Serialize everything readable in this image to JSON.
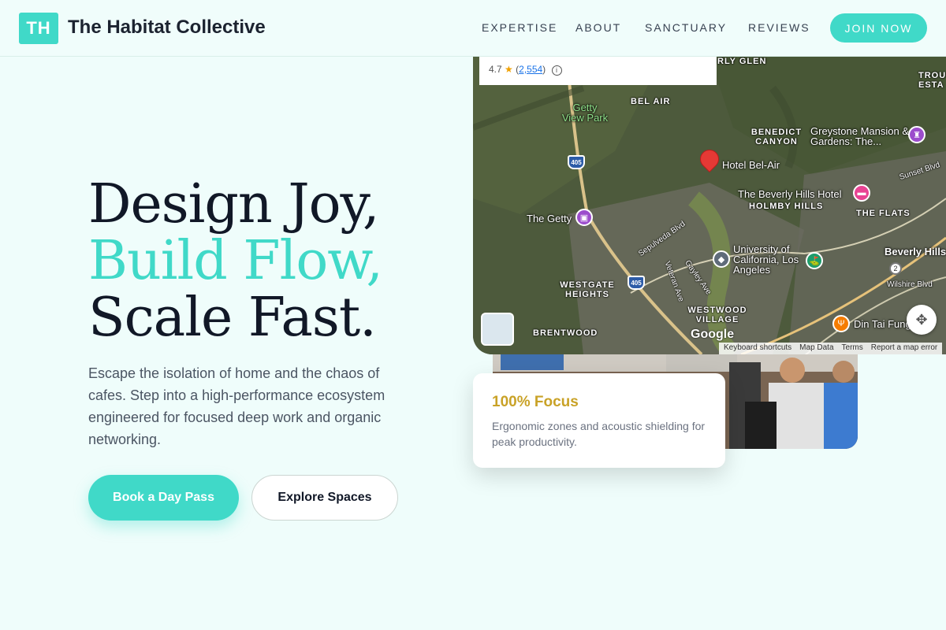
{
  "header": {
    "logo_text": "TH",
    "brand": "The Habitat Collective",
    "nav": [
      "EXPERTISE",
      "ABOUT",
      "SANCTUARY",
      "REVIEWS"
    ],
    "cta": "JOIN NOW"
  },
  "hero": {
    "line1": "Design Joy,",
    "line2": "Build Flow,",
    "line3": "Scale Fast.",
    "description": "Escape the isolation of home and the chaos of cafes. Step into a high-performance ecosystem engineered for focused deep work and organic networking.",
    "primary_button": "Book a Day Pass",
    "secondary_button": "Explore Spaces"
  },
  "map": {
    "rating": "4.7",
    "review_count": "2,554",
    "areas": [
      "RLY GLEN",
      "BEL AIR",
      "BENEDICT CANYON",
      "HOLMBY HILLS",
      "THE FLATS",
      "WESTGATE HEIGHTS",
      "WESTWOOD VILLAGE",
      "BRENTWOOD",
      "TROUS ESTA"
    ],
    "places": [
      "Getty View Park",
      "Greystone Mansion & Gardens: The...",
      "Hotel Bel-Air",
      "The Beverly Hills Hotel",
      "The Getty",
      "University of California, Los Angeles",
      "Beverly Hills",
      "Din Tai Fung"
    ],
    "streets": [
      "Sunset Blvd",
      "Sepulveda Blvd",
      "Veteran Ave",
      "Wilshire Blvd",
      "Gayley Ave"
    ],
    "highway": "405",
    "route_marker": "2",
    "google": "Google",
    "attribution": [
      "Keyboard shortcuts",
      "Map Data",
      "Terms",
      "Report a map error"
    ]
  },
  "focus_card": {
    "title": "100% Focus",
    "text": "Ergonomic zones and acoustic shielding for peak productivity."
  },
  "colors": {
    "accent": "#40d9c8",
    "gold": "#c9a227",
    "background": "#effdfb"
  }
}
